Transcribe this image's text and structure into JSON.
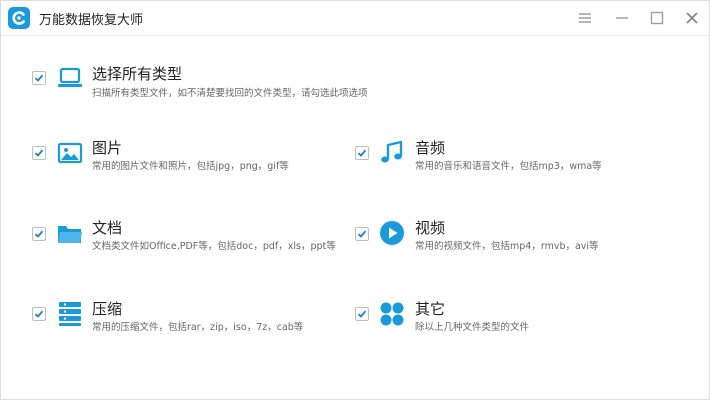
{
  "app": {
    "title": "万能数据恢复大师"
  },
  "window_controls": {
    "menu_icon": "hamburger-menu-icon",
    "minimize_icon": "minimize-icon",
    "maximize_icon": "maximize-icon",
    "close_icon": "close-icon"
  },
  "colors": {
    "accent": "#1a9bd9",
    "checkbox_check": "#1a7fc4",
    "title_text": "#222222",
    "desc_text": "#666666"
  },
  "options": {
    "all": {
      "checked": true,
      "icon": "laptop-icon",
      "title": "选择所有类型",
      "desc": "扫描所有类型文件，如不清楚要找回的文件类型，请勾选此项选项"
    },
    "images": {
      "checked": true,
      "icon": "picture-icon",
      "title": "图片",
      "desc": "常用的图片文件和照片，包括jpg，png，gif等"
    },
    "audio": {
      "checked": true,
      "icon": "music-note-icon",
      "title": "音频",
      "desc": "常用的音乐和语音文件，包括mp3，wma等"
    },
    "documents": {
      "checked": true,
      "icon": "folder-icon",
      "title": "文档",
      "desc": "文档类文件如Office,PDF等，包括doc，pdf，xls，ppt等"
    },
    "video": {
      "checked": true,
      "icon": "play-circle-icon",
      "title": "视频",
      "desc": "常用的视频文件，包括mp4，rmvb，avi等"
    },
    "archives": {
      "checked": true,
      "icon": "archive-stack-icon",
      "title": "压缩",
      "desc": "常用的压缩文件，包括rar，zip，iso，7z，cab等"
    },
    "others": {
      "checked": true,
      "icon": "four-dots-icon",
      "title": "其它",
      "desc": "除以上几种文件类型的文件"
    }
  }
}
